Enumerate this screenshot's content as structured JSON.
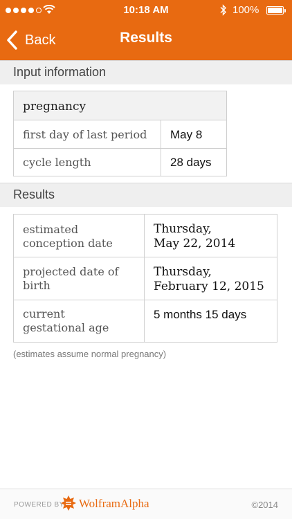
{
  "status_bar": {
    "time": "10:18 AM",
    "battery": "100%"
  },
  "nav": {
    "back_label": "Back",
    "title": "Results"
  },
  "input_section": {
    "header": "Input information",
    "table_title": "pregnancy",
    "rows": [
      {
        "label": "first day of last period",
        "value": "May 8"
      },
      {
        "label": "cycle length",
        "value": "28 days"
      }
    ]
  },
  "results_section": {
    "header": "Results",
    "rows": [
      {
        "label_line1": "estimated",
        "label_line2": "conception date",
        "value_line1": "Thursday,",
        "value_line2": "May 22, 2014"
      },
      {
        "label_line1": "projected date of",
        "label_line2": "birth",
        "value_line1": "Thursday,",
        "value_line2": "February 12, 2015"
      },
      {
        "label_line1": "current",
        "label_line2": "gestational age",
        "value_line1": "5 months 15 days",
        "value_line2": ""
      }
    ],
    "note": "(estimates assume normal pregnancy)"
  },
  "footer": {
    "powered_by": "POWERED BY",
    "brand": "WolframAlpha",
    "copyright": "©2014"
  },
  "colors": {
    "accent": "#e86a11",
    "section_bg": "#efefef"
  }
}
